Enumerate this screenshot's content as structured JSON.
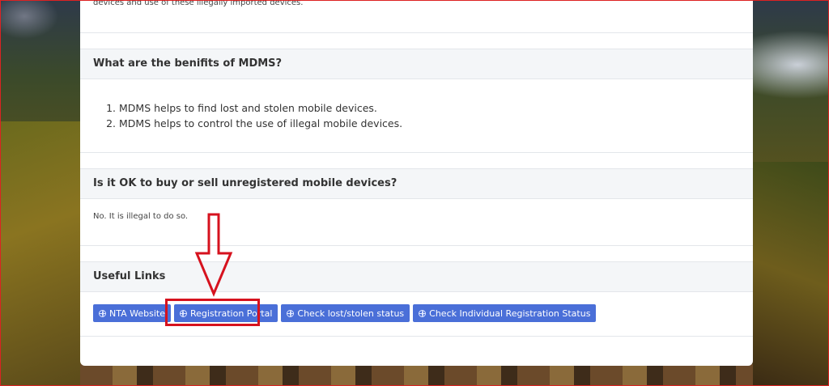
{
  "intro": {
    "text": "devices and use of these illegally imported devices."
  },
  "faq": [
    {
      "question": "What are the benifits of MDMS?",
      "answers": [
        "MDMS helps to find lost and stolen mobile devices.",
        "MDMS helps to control the use of illegal mobile devices."
      ]
    },
    {
      "question": "Is it OK to buy or sell unregistered mobile devices?",
      "answer": "No. It is illegal to do so."
    }
  ],
  "useful_links": {
    "title": "Useful Links",
    "buttons": [
      {
        "label": "NTA Website",
        "icon": "globe-icon"
      },
      {
        "label": "Registration Portal",
        "icon": "globe-icon"
      },
      {
        "label": "Check lost/stolen status",
        "icon": "globe-icon"
      },
      {
        "label": "Check Individual Registration Status",
        "icon": "globe-icon"
      }
    ]
  },
  "colors": {
    "button": "#4a6fd8",
    "annotation": "#d6121e"
  }
}
